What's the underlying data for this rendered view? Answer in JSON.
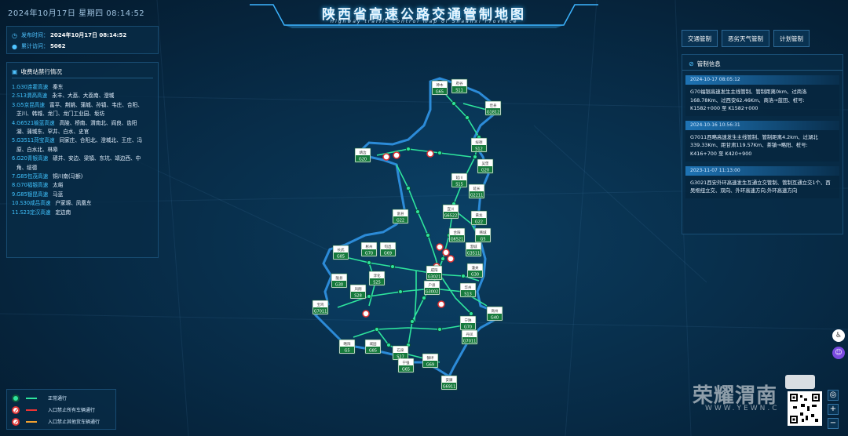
{
  "header": {
    "datetime": "2024年10月17日 星期四 08:14:52",
    "title": "陕西省高速公路交通管制地图",
    "subtitle": "Highway traffic control map of Shaanxi Province"
  },
  "info": {
    "publish_label": "发布时间：",
    "publish_value": "2024年10月17日 08:14:52",
    "visits_label": "累计访问：",
    "visits_value": "5062"
  },
  "closures": {
    "title": "收费站禁行情况",
    "items": [
      {
        "road": "1.G30连霍高速",
        "stations": "秦东"
      },
      {
        "road": "2.S13渭高高速",
        "stations": "永丰、大荔、大荔南、澄城"
      },
      {
        "road": "3.G5京昆高速",
        "stations": "富平、荆姚、蒲城、孙镇、韦庄、合阳、"
      },
      {
        "road": "",
        "stations": "芝川、韩城、龙门、龙门工业园、坂坊"
      },
      {
        "road": "4.G6521榆蓝高速",
        "stations": "高陵、桥南、渭南北、阎良、齿阳"
      },
      {
        "road": "",
        "stations": "湖、蒲城东、罕井、白水、史官"
      },
      {
        "road": "5.G3511菏宝高速",
        "stations": "同家庄、合阳北、澄城北、王庄、冯"
      },
      {
        "road": "",
        "stations": "原、白水北、林皋"
      },
      {
        "road": "6.G20青银高速",
        "stations": "碛井、安边、梁镇、东坑、靖边西、中"
      },
      {
        "road": "",
        "stations": "角、绥德"
      },
      {
        "road": "7.G85包茂高速",
        "stations": "铜川南(马额)"
      },
      {
        "road": "8.G70福银高速",
        "stations": "太峪"
      },
      {
        "road": "9.G85银昆高速",
        "stations": "马蓝"
      },
      {
        "road": "10.S30咸吕高速",
        "stations": "户家塬、凤凰东"
      },
      {
        "road": "11.S23定汉高速",
        "stations": "定边南"
      }
    ]
  },
  "legend": [
    {
      "label": "正常通行"
    },
    {
      "label": "入口禁止所有车辆通行"
    },
    {
      "label": "入口禁止其他货车辆通行"
    }
  ],
  "tabs": [
    {
      "label": "交通管制"
    },
    {
      "label": "恶劣天气管制"
    },
    {
      "label": "计划管制"
    }
  ],
  "control_info": {
    "title": "管制信息",
    "cards": [
      {
        "date": "2024-10-17 08:05:12",
        "text": "G70福银高速发生主线管制、管制距离0km、过商洛168.78Km、过西安62.46Km、商洛→蓝田、桩号: K1582+000 至 K1582+000"
      },
      {
        "date": "2024-10-16 10:56:31",
        "text": "G7011西略高速发生主线管制、管制距离4.2km、过湖北339.33Km、距甘肃119.57Km、茶镇→略阳、桩号: K416+700 至 K420+900"
      },
      {
        "date": "2023-11-07 11:13:00",
        "text": "G3021西安外环高速发生互通立交管制、管制互通立交1个、西吴枢纽立交、双向、外环高速方向,外环高速方向"
      }
    ]
  },
  "map": {
    "highway_labels": [
      {
        "city": "府谷",
        "code": "S11"
      },
      {
        "city": "神木",
        "code": "G65"
      },
      {
        "city": "佳县",
        "code": "G1812"
      },
      {
        "city": "绥德",
        "code": "S12"
      },
      {
        "city": "吴堡",
        "code": "G20"
      },
      {
        "city": "靖边",
        "code": "G20"
      },
      {
        "city": "延川",
        "code": "S15"
      },
      {
        "city": "延长",
        "code": "G2211"
      },
      {
        "city": "宜川",
        "code": "G6522"
      },
      {
        "city": "富县",
        "code": "G22"
      },
      {
        "city": "黄龙",
        "code": "G22"
      },
      {
        "city": "韩城",
        "code": "G5"
      },
      {
        "city": "合阳",
        "code": "G6521"
      },
      {
        "city": "澄城",
        "code": "G3511"
      },
      {
        "city": "长武",
        "code": "G85"
      },
      {
        "city": "彬州",
        "code": "G70"
      },
      {
        "city": "旬邑",
        "code": "G69"
      },
      {
        "city": "淳化",
        "code": "S25"
      },
      {
        "city": "咸阳",
        "code": "G3021"
      },
      {
        "city": "潼关",
        "code": "G30"
      },
      {
        "city": "陇县",
        "code": "G30"
      },
      {
        "city": "凤翔",
        "code": "S28"
      },
      {
        "city": "户县",
        "code": "G3002"
      },
      {
        "city": "华州",
        "code": "S13"
      },
      {
        "city": "商州",
        "code": "G40"
      },
      {
        "city": "宝鸡",
        "code": "G7011"
      },
      {
        "city": "宁陕",
        "code": "G70"
      },
      {
        "city": "丹凤",
        "code": "G7011"
      },
      {
        "city": "略阳",
        "code": "G5"
      },
      {
        "city": "城固",
        "code": "G85"
      },
      {
        "city": "石泉",
        "code": "S27"
      },
      {
        "city": "宁强",
        "code": "G65"
      },
      {
        "city": "镇坪",
        "code": "G69"
      },
      {
        "city": "安康",
        "code": "G6911"
      }
    ]
  },
  "watermark": {
    "brand": "荣耀渭南",
    "url": "WWW.YEWN.C"
  }
}
